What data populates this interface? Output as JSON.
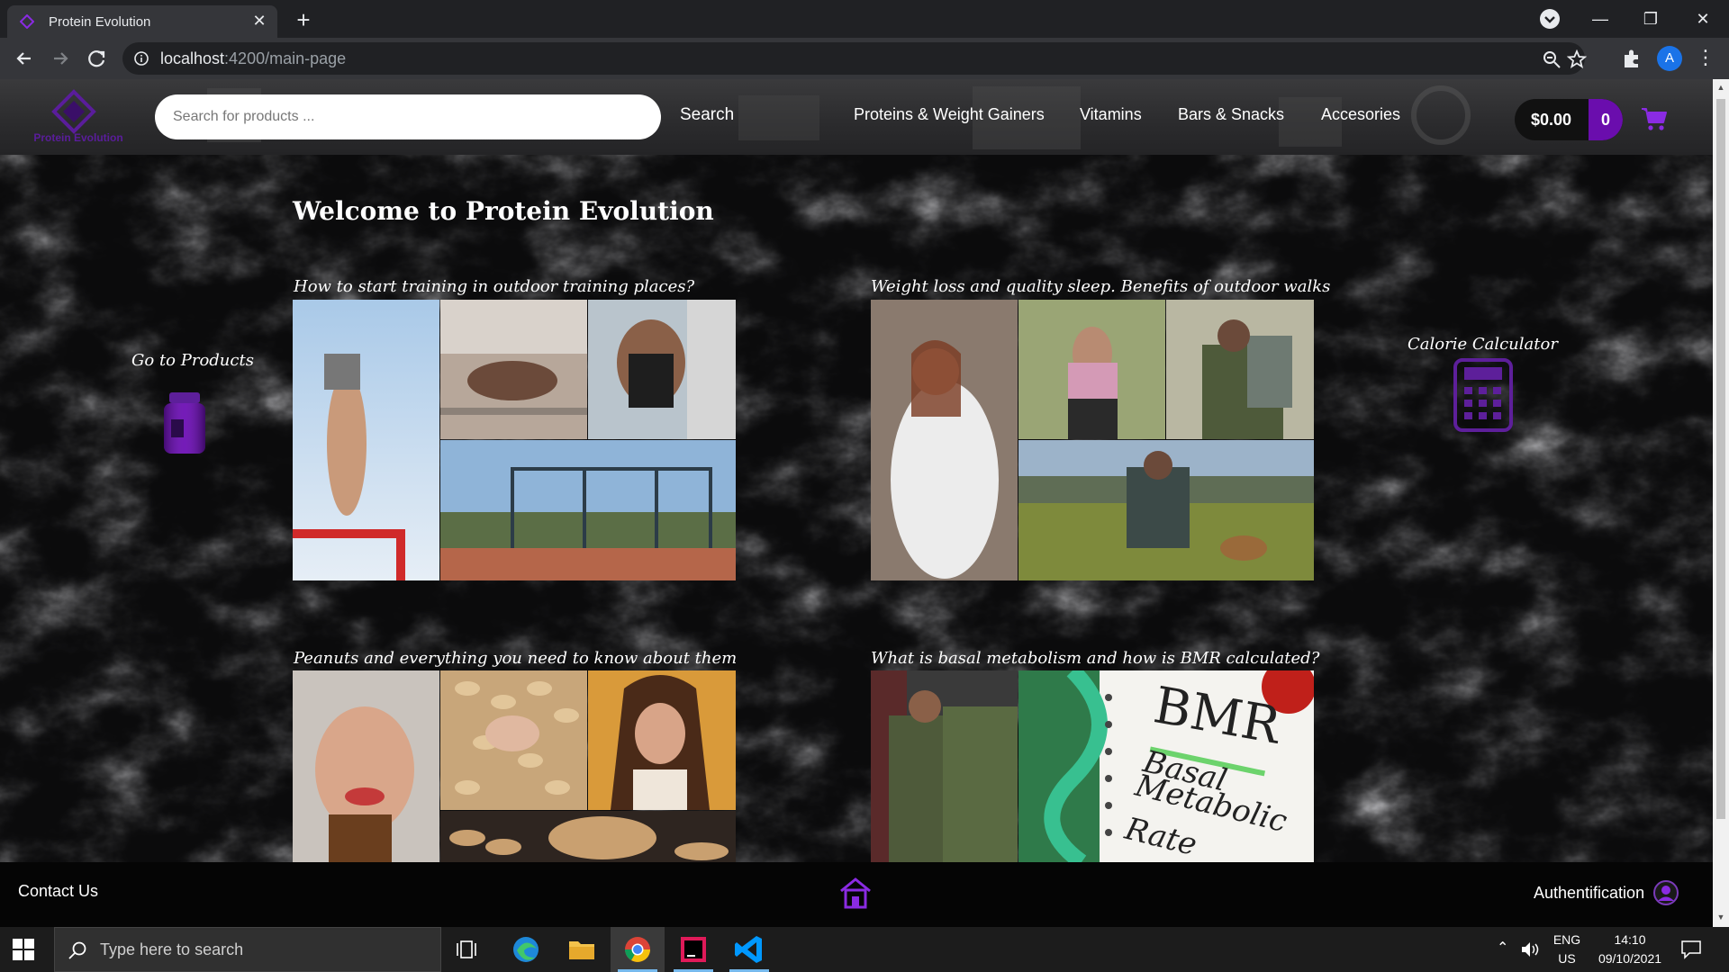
{
  "browser": {
    "tab_title": "Protein Evolution",
    "url_host": "localhost",
    "url_path": ":4200/main-page",
    "profile_initial": "A"
  },
  "header": {
    "logo_text": "Protein Evolution",
    "search_placeholder": "Search for products ...",
    "search_label": "Search",
    "nav": [
      "Proteins & Weight Gainers",
      "Vitamins",
      "Bars & Snacks",
      "Accesories"
    ],
    "cart_total": "$0.00",
    "cart_count": "0"
  },
  "main": {
    "welcome": "Welcome to Protein Evolution",
    "go_to_products": "Go to Products",
    "calorie_calculator": "Calorie Calculator",
    "articles": [
      {
        "title": "How to start training in outdoor training places?"
      },
      {
        "title": "Weight loss and quality sleep. Benefits of outdoor walks"
      },
      {
        "title": "Peanuts and everything you need to know about them"
      },
      {
        "title": "What is basal metabolism and how is BMR calculated?"
      }
    ],
    "bmr_image_text": [
      "BMR",
      "Basal",
      "Metabolic",
      "Rate"
    ]
  },
  "footer": {
    "contact": "Contact Us",
    "auth": "Authentification"
  },
  "taskbar": {
    "search_placeholder": "Type here to search",
    "lang_top": "ENG",
    "lang_bottom": "US",
    "time": "14:10",
    "date": "09/10/2021"
  },
  "colors": {
    "accent": "#6a0dad",
    "accent_light": "#8a2be2",
    "page_bg": "#0e0e0f"
  }
}
